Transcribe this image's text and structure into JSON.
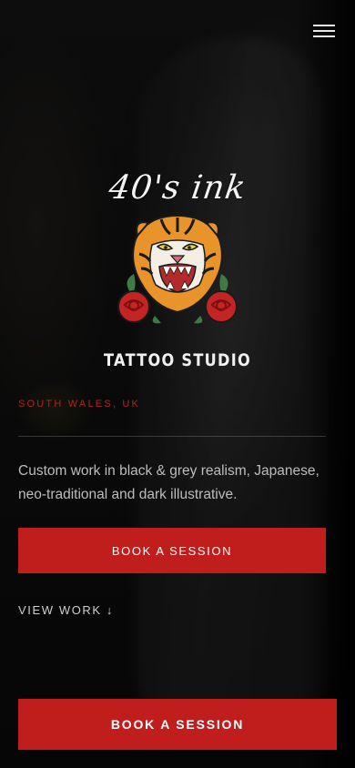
{
  "header": {
    "menu_icon": "hamburger-menu-icon"
  },
  "logo": {
    "script_text": "40's ink",
    "emblem": "tiger-head-with-roses"
  },
  "hero": {
    "studio_label": "TATTOO STUDIO",
    "location": "SOUTH WALES, UK",
    "description": "Custom work in black & grey realism, Japanese, neo-traditional and dark illustrative.",
    "book_button_label": "BOOK A SESSION",
    "view_work_label": "VIEW WORK ↓"
  },
  "sticky_cta": {
    "label": "BOOK A SESSION"
  },
  "colors": {
    "accent": "#c01d1d",
    "background": "#0b0b0b",
    "text": "#e8e8e8"
  }
}
